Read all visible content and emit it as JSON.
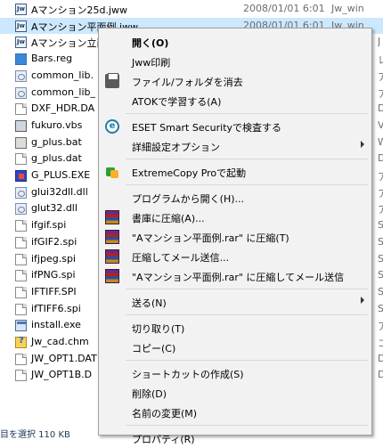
{
  "files": [
    {
      "name": "Aマンション25d.jww",
      "icon": "jw-cad-icon",
      "date": "2008/01/01 6:01",
      "type": "Jw_win",
      "tail": ""
    },
    {
      "name": "Aマンション平面例.jww",
      "icon": "jw-cad-icon",
      "date": "2008/01/01 6:01",
      "type": "Jw_win",
      "tail": "",
      "selected": true
    },
    {
      "name": "Aマンション立面",
      "icon": "jw-cad-icon",
      "date": "",
      "type": "",
      "tail": "J"
    },
    {
      "name": "Bars.reg",
      "icon": "registry-icon",
      "date": "",
      "type": "",
      "tail": "レ"
    },
    {
      "name": "common_lib.",
      "icon": "dll-icon",
      "date": "",
      "type": "",
      "tail": "ア"
    },
    {
      "name": "common_lib_",
      "icon": "dll-icon",
      "date": "",
      "type": "",
      "tail": "ア"
    },
    {
      "name": "DXF_HDR.DA",
      "icon": "file-icon",
      "date": "",
      "type": "",
      "tail": "D"
    },
    {
      "name": "fukuro.vbs",
      "icon": "script-icon",
      "date": "",
      "type": "",
      "tail": "V"
    },
    {
      "name": "g_plus.bat",
      "icon": "batch-icon",
      "date": "",
      "type": "",
      "tail": "W"
    },
    {
      "name": "g_plus.dat",
      "icon": "file-icon",
      "date": "",
      "type": "",
      "tail": "D"
    },
    {
      "name": "G_PLUS.EXE",
      "icon": "g-plus-app-icon",
      "date": "",
      "type": "",
      "tail": "ア"
    },
    {
      "name": "glui32dll.dll",
      "icon": "dll-icon",
      "date": "",
      "type": "",
      "tail": "ア"
    },
    {
      "name": "glut32.dll",
      "icon": "dll-icon",
      "date": "",
      "type": "",
      "tail": "ア"
    },
    {
      "name": "ifgif.spi",
      "icon": "file-icon",
      "date": "",
      "type": "",
      "tail": "S"
    },
    {
      "name": "ifGIF2.spi",
      "icon": "file-icon",
      "date": "",
      "type": "",
      "tail": "S"
    },
    {
      "name": "ifjpeg.spi",
      "icon": "file-icon",
      "date": "",
      "type": "",
      "tail": "S"
    },
    {
      "name": "ifPNG.spi",
      "icon": "file-icon",
      "date": "",
      "type": "",
      "tail": "S"
    },
    {
      "name": "IFTIFF.SPI",
      "icon": "file-icon",
      "date": "",
      "type": "",
      "tail": "S"
    },
    {
      "name": "ifTIFF6.spi",
      "icon": "file-icon",
      "date": "",
      "type": "",
      "tail": "S"
    },
    {
      "name": "install.exe",
      "icon": "installer-icon",
      "date": "",
      "type": "",
      "tail": "ア"
    },
    {
      "name": "Jw_cad.chm",
      "icon": "help-file-icon",
      "date": "",
      "type": "",
      "tail": "コ"
    },
    {
      "name": "JW_OPT1.DAT",
      "icon": "file-icon",
      "date": "",
      "type": "",
      "tail": "D"
    },
    {
      "name": "JW_OPT1B.D",
      "icon": "file-icon",
      "date": "",
      "type": "",
      "tail": "D"
    },
    {
      "name": "",
      "icon": "",
      "date": "",
      "type": "",
      "tail": ""
    }
  ],
  "status": {
    "text": "目を選択 110 KB"
  },
  "menu": {
    "items": [
      {
        "kind": "item",
        "label": "開く(O)",
        "bold": true,
        "icon": ""
      },
      {
        "kind": "item",
        "label": "Jww印刷",
        "icon": ""
      },
      {
        "kind": "item",
        "label": "ファイル/フォルダを消去",
        "icon": "printer-icon"
      },
      {
        "kind": "item",
        "label": "ATOKで学習する(A)",
        "icon": ""
      },
      {
        "kind": "sep"
      },
      {
        "kind": "item",
        "label": "ESET Smart Securityで検査する",
        "icon": "eset-icon"
      },
      {
        "kind": "item",
        "label": "詳細設定オプション",
        "icon": "",
        "submenu": true
      },
      {
        "kind": "sep"
      },
      {
        "kind": "item",
        "label": "ExtremeCopy Proで起動",
        "icon": "extremecopy-icon"
      },
      {
        "kind": "sep"
      },
      {
        "kind": "item",
        "label": "プログラムから開く(H)...",
        "icon": ""
      },
      {
        "kind": "item",
        "label": "書庫に圧縮(A)...",
        "icon": "winrar-icon"
      },
      {
        "kind": "item",
        "label": "\"Aマンション平面例.rar\" に圧縮(T)",
        "icon": "winrar-icon"
      },
      {
        "kind": "item",
        "label": "圧縮してメール送信...",
        "icon": "winrar-icon"
      },
      {
        "kind": "item",
        "label": "\"Aマンション平面例.rar\" に圧縮してメール送信",
        "icon": "winrar-icon"
      },
      {
        "kind": "sep"
      },
      {
        "kind": "item",
        "label": "送る(N)",
        "icon": "",
        "submenu": true
      },
      {
        "kind": "sep"
      },
      {
        "kind": "item",
        "label": "切り取り(T)",
        "icon": ""
      },
      {
        "kind": "item",
        "label": "コピー(C)",
        "icon": ""
      },
      {
        "kind": "sep"
      },
      {
        "kind": "item",
        "label": "ショートカットの作成(S)",
        "icon": ""
      },
      {
        "kind": "item",
        "label": "削除(D)",
        "icon": ""
      },
      {
        "kind": "item",
        "label": "名前の変更(M)",
        "icon": ""
      },
      {
        "kind": "sep"
      },
      {
        "kind": "item",
        "label": "プロパティ(R)",
        "icon": ""
      }
    ]
  },
  "colors": {
    "selection": "#cce8ff",
    "menu_bg": "#f2f2f2",
    "status_text": "#1e395b"
  }
}
